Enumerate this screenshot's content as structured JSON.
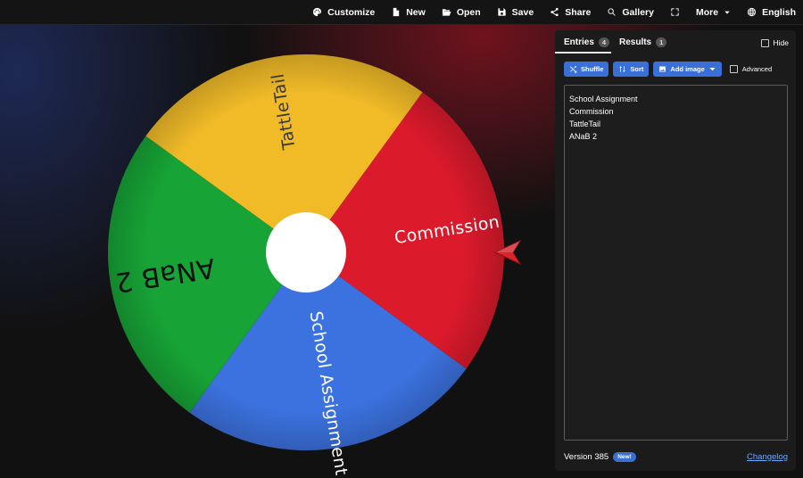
{
  "topbar": {
    "items": [
      {
        "label": "Customize",
        "icon": "palette-icon"
      },
      {
        "label": "New",
        "icon": "new-file-icon"
      },
      {
        "label": "Open",
        "icon": "folder-open-icon"
      },
      {
        "label": "Save",
        "icon": "save-icon"
      },
      {
        "label": "Share",
        "icon": "share-icon"
      },
      {
        "label": "Gallery",
        "icon": "search-icon"
      },
      {
        "label": "",
        "icon": "fullscreen-icon"
      },
      {
        "label": "More",
        "icon": "chevron-down-icon"
      },
      {
        "label": "English",
        "icon": "globe-icon"
      }
    ]
  },
  "wheel": {
    "segments": [
      {
        "label": "Commission",
        "color": "#db1a2c"
      },
      {
        "label": "School Assignment",
        "color": "#3c72e0"
      },
      {
        "label": "ANaB 2",
        "color": "#17a336"
      },
      {
        "label": "TattleTail",
        "color": "#f1bb28"
      }
    ],
    "center_color": "#ffffff",
    "pointer_color": "#d9242c"
  },
  "panel": {
    "tabs": [
      {
        "label": "Entries",
        "count": "4",
        "active": true
      },
      {
        "label": "Results",
        "count": "1",
        "active": false
      }
    ],
    "hide_label": "Hide",
    "buttons": {
      "shuffle": "Shuffle",
      "sort": "Sort",
      "add_image": "Add image"
    },
    "advanced_label": "Advanced",
    "entries": [
      "School Assignment",
      "Commission",
      "TattleTail",
      "ANaB 2"
    ],
    "version": "Version 385",
    "new_badge": "New!",
    "changelog": "Changelog",
    "accent_color": "#3a6fd8"
  }
}
